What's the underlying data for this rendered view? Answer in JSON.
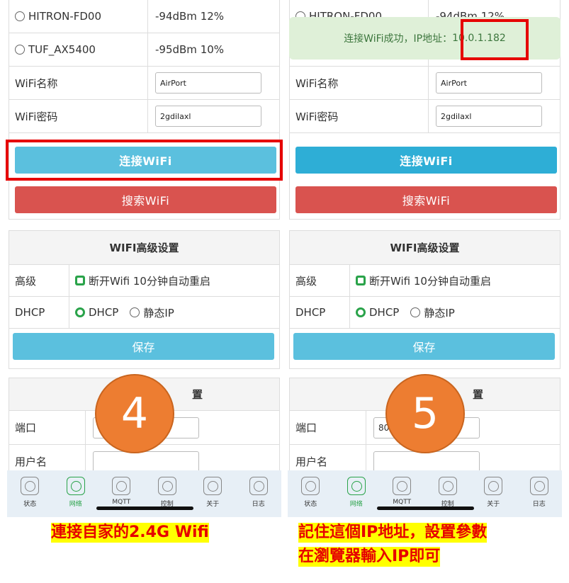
{
  "wifi_list": [
    {
      "ssid": "HITRON-FD00",
      "signal": "-94dBm 12%"
    },
    {
      "ssid": "TUF_AX5400",
      "signal": "-95dBm 10%"
    }
  ],
  "wifi_name_label": "WiFi名称",
  "wifi_name_value": "AirPort",
  "wifi_password_label": "WiFi密码",
  "wifi_password_value": "2gdilaxl",
  "connect_button": "连接WiFi",
  "search_button": "搜索WiFi",
  "advanced": {
    "title": "WIFI高级设置",
    "advanced_label": "高级",
    "restart_option": "断开Wifi 10分钟自动重启",
    "dhcp_label": "DHCP",
    "dhcp_option": "DHCP",
    "static_option": "静态IP",
    "save_button": "保存"
  },
  "port_section": {
    "title": "置",
    "port_label": "端口",
    "port_value": "80",
    "username_label": "用户名"
  },
  "tabs": [
    "状态",
    "网络",
    "MQTT",
    "控制",
    "关于",
    "日志"
  ],
  "toast": {
    "prefix": "连接WiFi成功，IP地址：",
    "ip": "10.0.1.182"
  },
  "steps": {
    "left": "4",
    "right": "5"
  },
  "captions": {
    "left": "連接自家的2.4G Wifi",
    "right_line1": "記住這個IP地址，設置參數",
    "right_line2": "在瀏覽器輸入IP即可"
  },
  "colors": {
    "accent_blue": "#5bc0de",
    "danger_red": "#d9534f",
    "success_green": "#2aa34a",
    "step_orange": "#ed7d31",
    "highlight_red": "#e60000"
  }
}
